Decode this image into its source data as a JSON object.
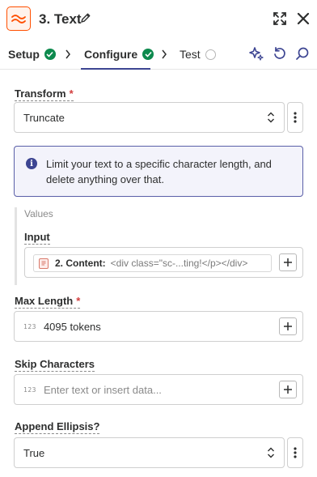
{
  "header": {
    "title": "3. Text",
    "icons": [
      "app-logo-icon",
      "pencil-icon",
      "expand-icon",
      "close-icon"
    ],
    "accent_color": "#ff4f00"
  },
  "tabs": [
    {
      "label": "Setup",
      "status": "complete"
    },
    {
      "label": "Configure",
      "status": "complete",
      "active": true
    },
    {
      "label": "Test",
      "status": "pending"
    }
  ],
  "toolbar_icons": [
    "sparkle-icon",
    "refresh-icon",
    "search-icon"
  ],
  "transform": {
    "label": "Transform",
    "required_mark": "*",
    "value": "Truncate"
  },
  "info": {
    "text": "Limit your text to a specific character length, and delete anything over that."
  },
  "values": {
    "title": "Values",
    "input": {
      "label": "Input",
      "pill_label": "2. Content:",
      "pill_value": "<div class=\"sc-...ting!</p></div>"
    }
  },
  "max_length": {
    "label": "Max Length",
    "required_mark": "*",
    "type_tag": "123",
    "value": "4095 tokens"
  },
  "skip_characters": {
    "label": "Skip Characters",
    "type_tag": "123",
    "placeholder": "Enter text or insert data..."
  },
  "append_ellipsis": {
    "label": "Append Ellipsis?",
    "value": "True"
  },
  "colors": {
    "success": "#0d8a4e",
    "active_tab": "#3d4592",
    "required": "#d23d3d",
    "info_border": "#5a5fa8"
  }
}
